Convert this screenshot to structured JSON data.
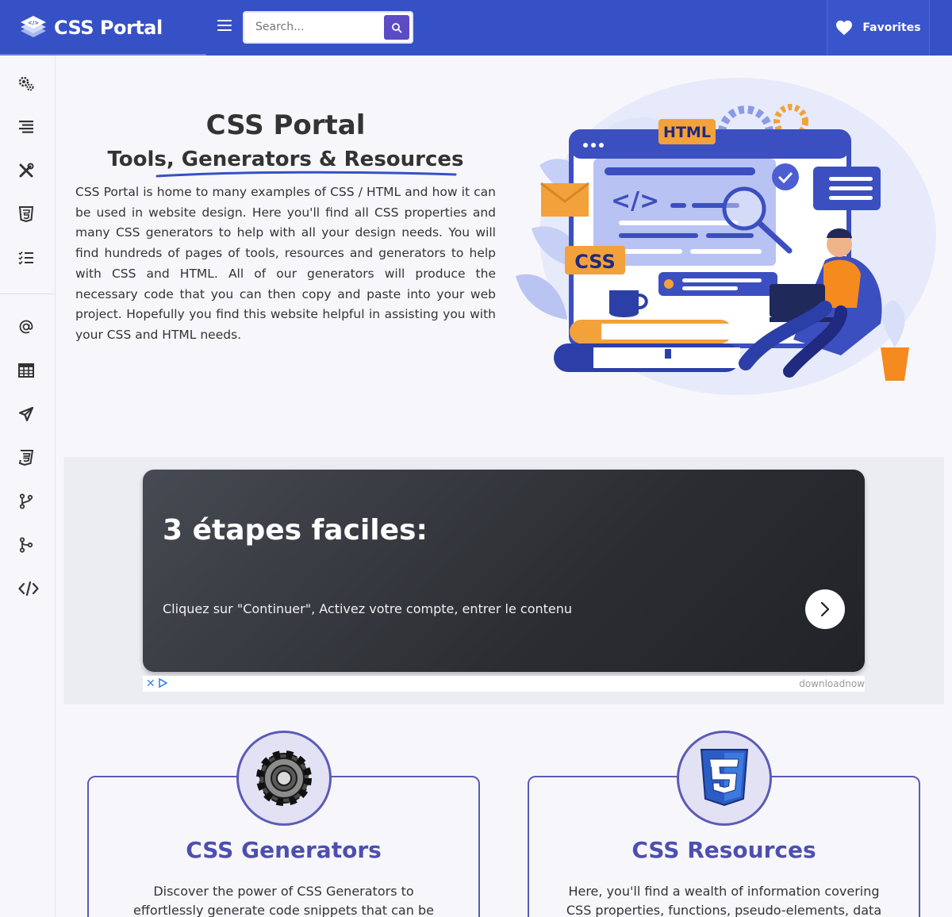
{
  "header": {
    "logo_text": "CSS Portal",
    "search_placeholder": "Search...",
    "favorites_label": "Favorites"
  },
  "sidebar": {
    "items": [
      {
        "icon": "gears-icon"
      },
      {
        "icon": "align-right-icon"
      },
      {
        "icon": "tools-icon"
      },
      {
        "icon": "html5-icon"
      },
      {
        "icon": "checklist-icon"
      },
      {
        "icon": "at-sign-icon"
      },
      {
        "icon": "table-icon"
      },
      {
        "icon": "send-icon"
      },
      {
        "icon": "css3-icon"
      },
      {
        "icon": "git-branch-icon"
      },
      {
        "icon": "git-merge-icon"
      },
      {
        "icon": "code-icon"
      }
    ]
  },
  "hero": {
    "title": "CSS Portal",
    "subtitle": "Tools, Generators & Resources",
    "description": "CSS Portal is home to many examples of CSS / HTML and how it can be used in website design. Here you'll find all CSS properties and many CSS generators to help with all your design needs. You will find hundreds of pages of tools, resources and generators to help with CSS and HTML. All of our generators will produce the necessary code that you can then copy and paste into your web project. Hopefully you find this website helpful in assisting you with your CSS and HTML needs.",
    "illustration": {
      "html_label": "HTML",
      "css_label": "CSS",
      "code_label": "</>"
    }
  },
  "ad": {
    "title": "3 étapes faciles:",
    "text": "Cliquez sur \"Continuer\", Activez votre compte, entrer le contenu",
    "brand": "downloadnow",
    "close_glyph": "✕"
  },
  "cards": [
    {
      "title": "CSS Generators",
      "text": "Discover the power of CSS Generators to effortlessly generate code snippets that can be seamlessly",
      "icon": "gear-icon"
    },
    {
      "title": "CSS Resources",
      "text": "Here, you'll find a wealth of information covering CSS properties, functions, pseudo-elements, data types and",
      "icon": "css3-shield-icon"
    }
  ],
  "colors": {
    "header_bg": "#3651c6",
    "accent": "#5b4bc4",
    "card_title": "#4d4fb0",
    "card_border": "#5b5bb6"
  }
}
